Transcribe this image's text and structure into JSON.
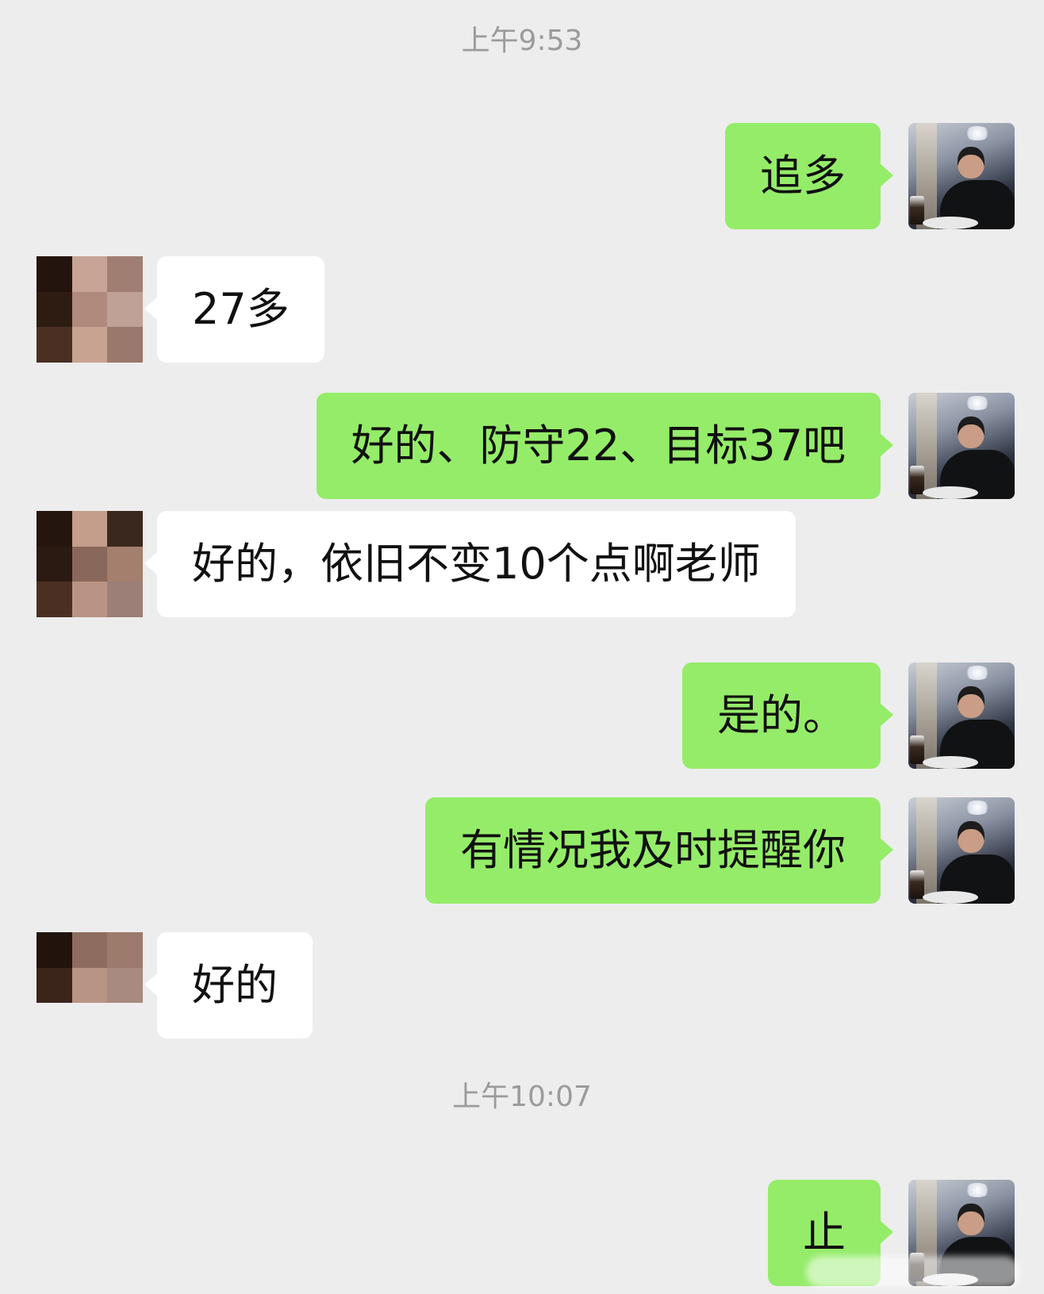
{
  "messages": [
    {
      "type": "time",
      "text": "上午9:53"
    },
    {
      "type": "out",
      "text": "追多"
    },
    {
      "type": "in",
      "text": "27多"
    },
    {
      "type": "out",
      "text": "好的、防守22、目标37吧"
    },
    {
      "type": "in",
      "text": "好的，依旧不变10个点啊老师"
    },
    {
      "type": "out",
      "text": "是的。"
    },
    {
      "type": "out",
      "text": "有情况我及时提醒你"
    },
    {
      "type": "in",
      "text": "好的"
    },
    {
      "type": "time",
      "text": "上午10:07"
    },
    {
      "type": "out",
      "text": "止"
    }
  ],
  "colors": {
    "background": "#ededed",
    "outgoing_bubble": "#95ec69",
    "incoming_bubble": "#ffffff",
    "timestamp_text": "#9b9b9b"
  },
  "avatars": {
    "self": "photo-avatar",
    "contact": "pixelated-avatar"
  }
}
